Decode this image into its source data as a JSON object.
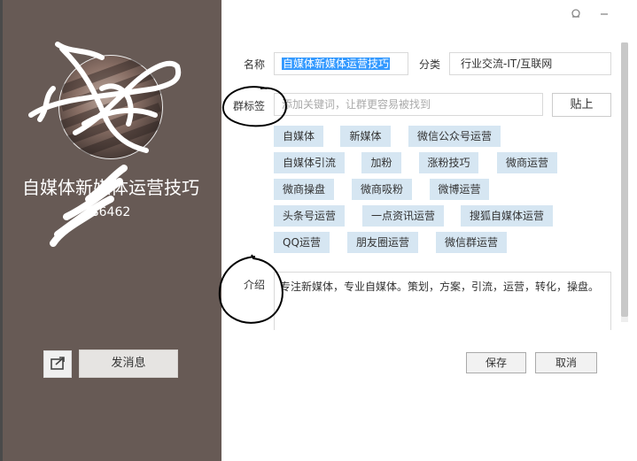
{
  "profile": {
    "group_name": "自媒体新媒体运营技巧",
    "group_id": "86462",
    "send_button": "发消息"
  },
  "form": {
    "name_label": "名称",
    "name_value": "自媒体新媒体运营技巧",
    "category_label": "分类",
    "category_value": "行业交流-IT/互联网",
    "tags_label": "群标签",
    "tags_placeholder": "添加关键词，让群更容易被找到",
    "paste_button": "贴上",
    "tags": [
      "自媒体",
      "新媒体",
      "微信公众号运营",
      "自媒体引流",
      "加粉",
      "涨粉技巧",
      "微商运营",
      "微商操盘",
      "微商吸粉",
      "微博运营",
      "头条号运营",
      "一点资讯运营",
      "搜狐自媒体运营",
      "QQ运营",
      "朋友圈运营",
      "微信群运营"
    ],
    "intro_label": "介绍",
    "intro_value": "专注新媒体，专业自媒体。策划，方案，引流，运营，转化，操盘。"
  },
  "actions": {
    "save": "保存",
    "cancel": "取消"
  },
  "icons": [
    "pin-icon",
    "minimize-icon",
    "share-icon"
  ]
}
